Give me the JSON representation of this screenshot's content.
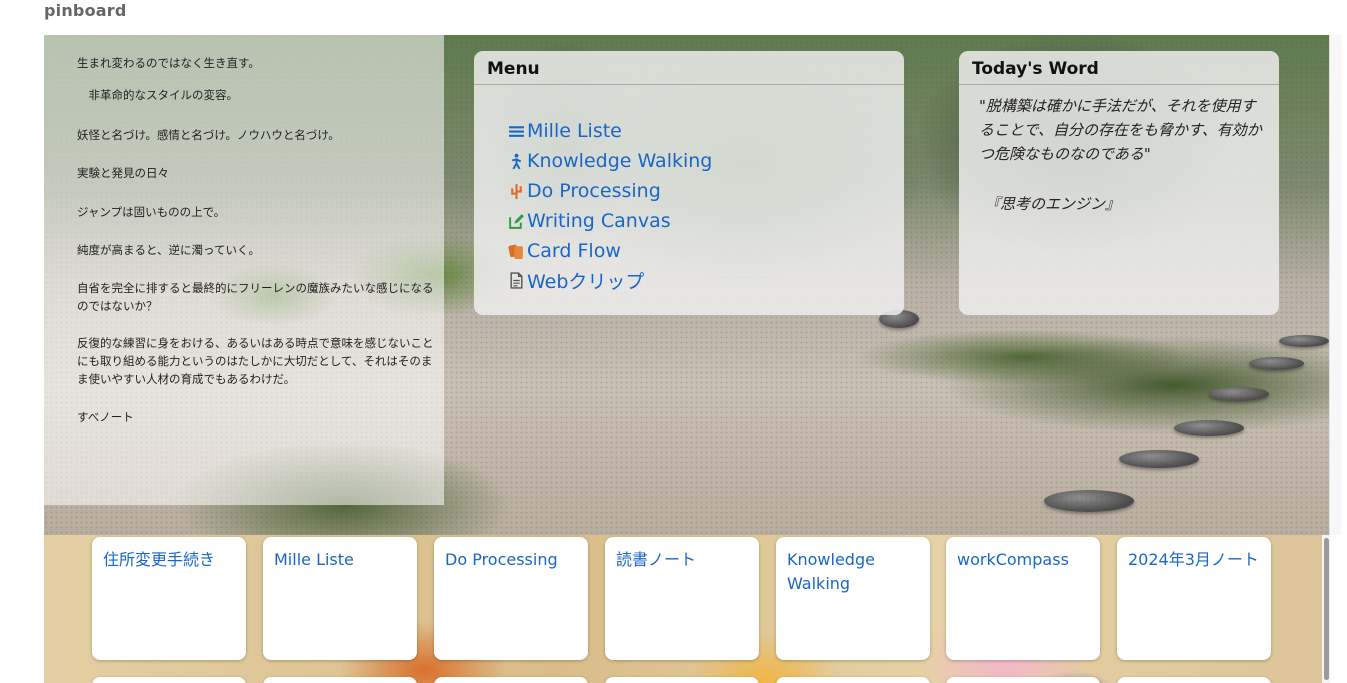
{
  "site_title": "pinboard",
  "thoughts": [
    "生まれ変わるのではなく生き直す。",
    "　非革命的なスタイルの変容。",
    "妖怪と名づけ。感情と名づけ。ノウハウと名づけ。",
    "実験と発見の日々",
    "ジャンプは固いものの上で。",
    "純度が高まると、逆に濁っていく。",
    "自省を完全に排すると最終的にフリーレンの魔族みたいな感じになるのではないか？",
    "反復的な練習に身をおける、あるいはある時点で意味を感じないことにも取り組める能力というのはたしかに大切だとして、それはそのまま使いやすい人材の育成でもあるわけだ。",
    "すべノート"
  ],
  "menu": {
    "title": "Menu",
    "items": [
      {
        "label": "Mille Liste",
        "icon": "list-icon",
        "color": "#1a66c8"
      },
      {
        "label": "Knowledge Walking",
        "icon": "walking-person-icon",
        "color": "#1a66c8"
      },
      {
        "label": "Do Processing",
        "icon": "cactus-icon",
        "color": "#d9702a"
      },
      {
        "label": "Writing Canvas",
        "icon": "edit-icon",
        "color": "#2e9a44"
      },
      {
        "label": "Card Flow",
        "icon": "cards-icon",
        "color": "#d9702a"
      },
      {
        "label": "Webクリップ",
        "icon": "document-icon",
        "color": "#555555"
      }
    ]
  },
  "todays_word": {
    "title": "Today's Word",
    "quote": "\"脱構築は確かに手法だが、それを使用することで、自分の存在をも脅かす、有効かつ危険なものなのである\"",
    "source": "『思考のエンジン』"
  },
  "tiles": [
    {
      "label": "住所変更手続き"
    },
    {
      "label": "Mille Liste"
    },
    {
      "label": "Do Processing"
    },
    {
      "label": "読書ノート"
    },
    {
      "label": "Knowledge Walking"
    },
    {
      "label": "workCompass"
    },
    {
      "label": "2024年3月ノート"
    }
  ]
}
